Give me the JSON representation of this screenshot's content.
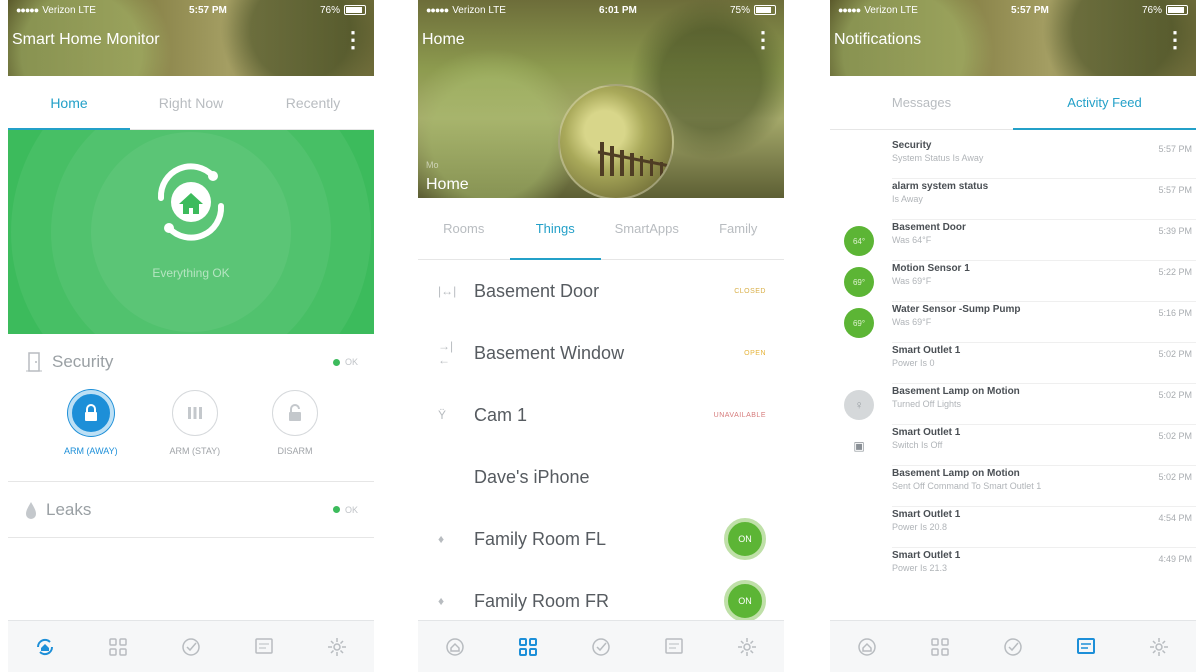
{
  "statusbar": {
    "s1": {
      "carrier": "Verizon  LTE",
      "time": "5:57 PM",
      "battery": "76%"
    },
    "s2": {
      "carrier": "Verizon  LTE",
      "time": "6:01 PM",
      "battery": "75%"
    },
    "s3": {
      "carrier": "Verizon  LTE",
      "time": "5:57 PM",
      "battery": "76%"
    }
  },
  "screen1": {
    "title": "Smart Home Monitor",
    "tabs": [
      "Home",
      "Right Now",
      "Recently"
    ],
    "hero_status": "Everything OK",
    "security_label": "Security",
    "security_status": "OK",
    "arm_buttons": [
      "ARM (AWAY)",
      "ARM (STAY)",
      "DISARM"
    ],
    "leaks_label": "Leaks",
    "leaks_status": "OK"
  },
  "screen2": {
    "title": "Home",
    "hero_small": "Mo",
    "hero_name": "Home",
    "tabs": [
      "Rooms",
      "Things",
      "SmartApps",
      "Family"
    ],
    "things": [
      {
        "name": "Basement Door",
        "status": "CLOSED"
      },
      {
        "name": "Basement Window",
        "status": "OPEN"
      },
      {
        "name": "Cam 1",
        "status": "UNAVAILABLE"
      },
      {
        "name": "Dave's iPhone",
        "status": ""
      },
      {
        "name": "Family Room FL",
        "status": "ON"
      },
      {
        "name": "Family Room FR",
        "status": "ON"
      }
    ]
  },
  "screen3": {
    "title": "Notifications",
    "tabs": [
      "Messages",
      "Activity Feed"
    ],
    "feed": [
      {
        "title": "Security",
        "sub": "System Status Is Away",
        "time": "5:57 PM",
        "badge": ""
      },
      {
        "title": "alarm system status",
        "sub": "Is Away",
        "time": "5:57 PM",
        "badge": ""
      },
      {
        "title": "Basement Door",
        "sub": "Was 64°F",
        "time": "5:39 PM",
        "badge": "64°"
      },
      {
        "title": "Motion Sensor 1",
        "sub": "Was 69°F",
        "time": "5:22 PM",
        "badge": "69°"
      },
      {
        "title": "Water Sensor -Sump Pump",
        "sub": "Was 69°F",
        "time": "5:16 PM",
        "badge": "69°"
      },
      {
        "title": "Smart Outlet 1",
        "sub": "Power Is 0",
        "time": "5:02 PM",
        "badge": ""
      },
      {
        "title": "Basement Lamp on Motion",
        "sub": "Turned Off Lights",
        "time": "5:02 PM",
        "badge": ""
      },
      {
        "title": "Smart Outlet 1",
        "sub": "Switch Is Off",
        "time": "5:02 PM",
        "badge": ""
      },
      {
        "title": "Basement Lamp on Motion",
        "sub": "Sent Off Command To Smart Outlet 1",
        "time": "5:02 PM",
        "badge": ""
      },
      {
        "title": "Smart Outlet 1",
        "sub": "Power Is 20.8",
        "time": "4:54 PM",
        "badge": ""
      },
      {
        "title": "Smart Outlet 1",
        "sub": "Power Is 21.3",
        "time": "4:49 PM",
        "badge": ""
      }
    ]
  },
  "colors": {
    "accent": "#23a0c8",
    "green": "#3cbb5c",
    "arm_blue": "#1d8fd8",
    "on_green": "#5cb535"
  }
}
